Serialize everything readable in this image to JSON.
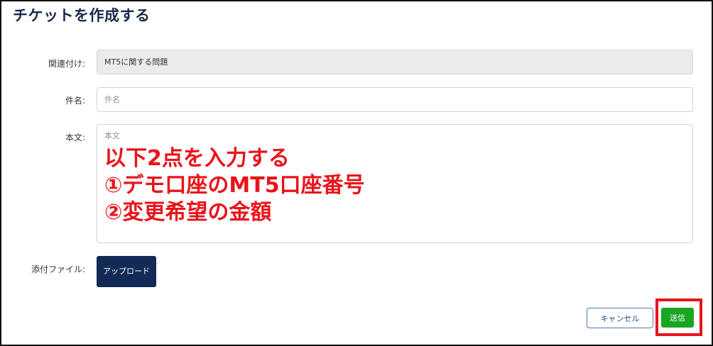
{
  "page": {
    "title": "チケットを作成する"
  },
  "form": {
    "related": {
      "label": "関連付け:",
      "value": "MT5に関する問題"
    },
    "subject": {
      "label": "件名:",
      "placeholder": "件名"
    },
    "body": {
      "label": "本文:",
      "placeholder": "本文"
    },
    "attachment": {
      "label": "添付ファイル:",
      "upload_label": "アップロード"
    }
  },
  "annotation": {
    "lines": [
      "以下2点を入力する",
      "①デモ口座のMT5口座番号",
      "②変更希望の金額"
    ],
    "color": "#e8141b"
  },
  "actions": {
    "cancel_label": "キャンセル",
    "submit_label": "送信"
  },
  "colors": {
    "title": "#1b2a4a",
    "upload_button": "#132a57",
    "submit_button": "#1aa522",
    "highlight": "#e8141b"
  }
}
